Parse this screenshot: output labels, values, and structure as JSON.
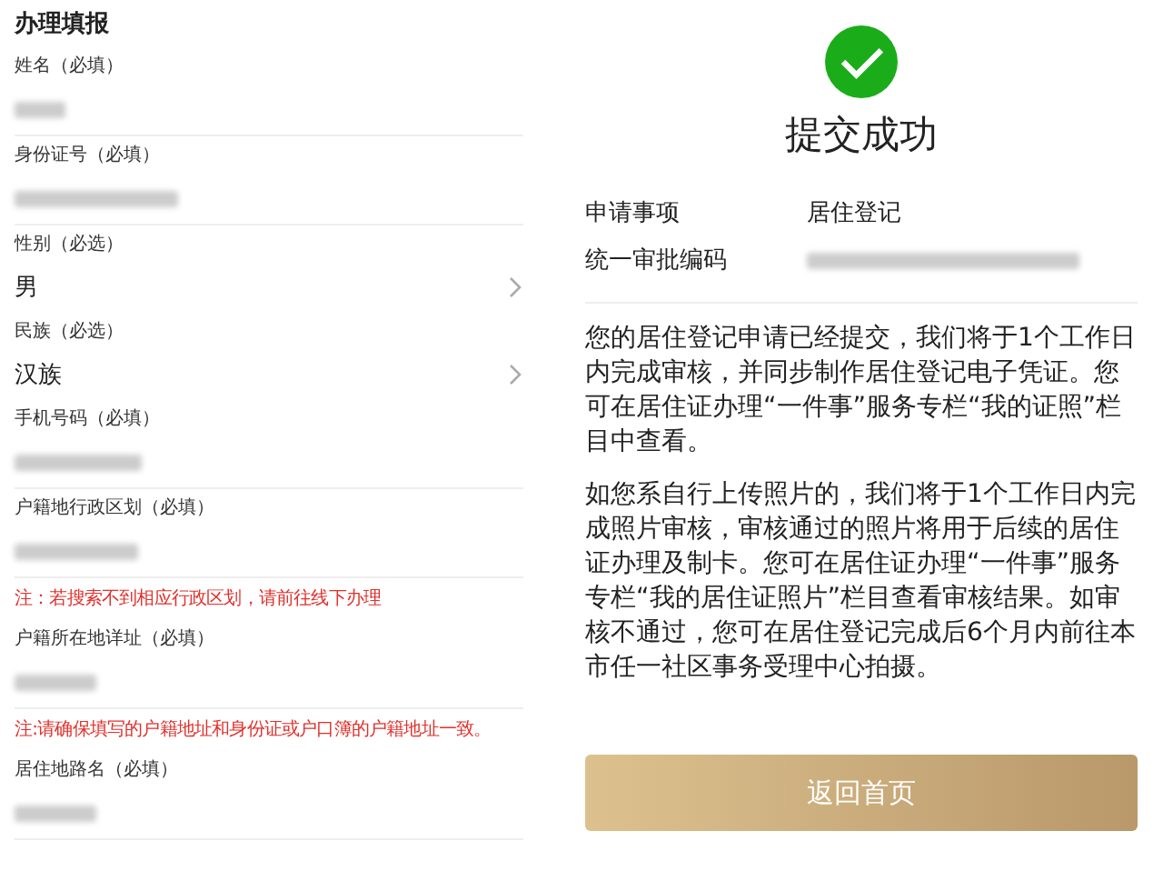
{
  "form": {
    "title": "办理填报",
    "items": [
      {
        "kind": "redacted",
        "label": "姓名（必填）"
      },
      {
        "kind": "redacted",
        "label": "身份证号（必填）"
      },
      {
        "kind": "select",
        "label": "性别（必选）",
        "value": "男"
      },
      {
        "kind": "select",
        "label": "民族（必选）",
        "value": "汉族"
      },
      {
        "kind": "redacted",
        "label": "手机号码（必填）"
      },
      {
        "kind": "redacted",
        "label": "户籍地行政区划（必填）"
      },
      {
        "kind": "note",
        "text": "注：若搜索不到相应行政区划，请前往线下办理"
      },
      {
        "kind": "redacted",
        "label": "户籍所在地详址（必填）"
      },
      {
        "kind": "note",
        "text": "注:请确保填写的户籍地址和身份证或户口簿的户籍地址一致。"
      },
      {
        "kind": "redacted",
        "label": "居住地路名（必填）"
      }
    ]
  },
  "result": {
    "title": "提交成功",
    "info": [
      {
        "kind": "text",
        "label": "申请事项",
        "value": "居住登记"
      },
      {
        "kind": "redacted",
        "label": "统一审批编码"
      }
    ],
    "paragraphs": [
      "您的居住登记申请已经提交，我们将于1个工作日内完成审核，并同步制作居住登记电子凭证。您可在居住证办理“一件事”服务专栏“我的证照”栏目中查看。",
      "如您系自行上传照片的，我们将于1个工作日内完成照片审核，审核通过的照片将用于后续的居住证办理及制卡。您可在居住证办理“一件事”服务专栏“我的居住证照片”栏目查看审核结果。如审核不通过，您可在居住登记完成后6个月内前往本市任一社区事务受理中心拍摄。"
    ],
    "button": "返回首页"
  }
}
